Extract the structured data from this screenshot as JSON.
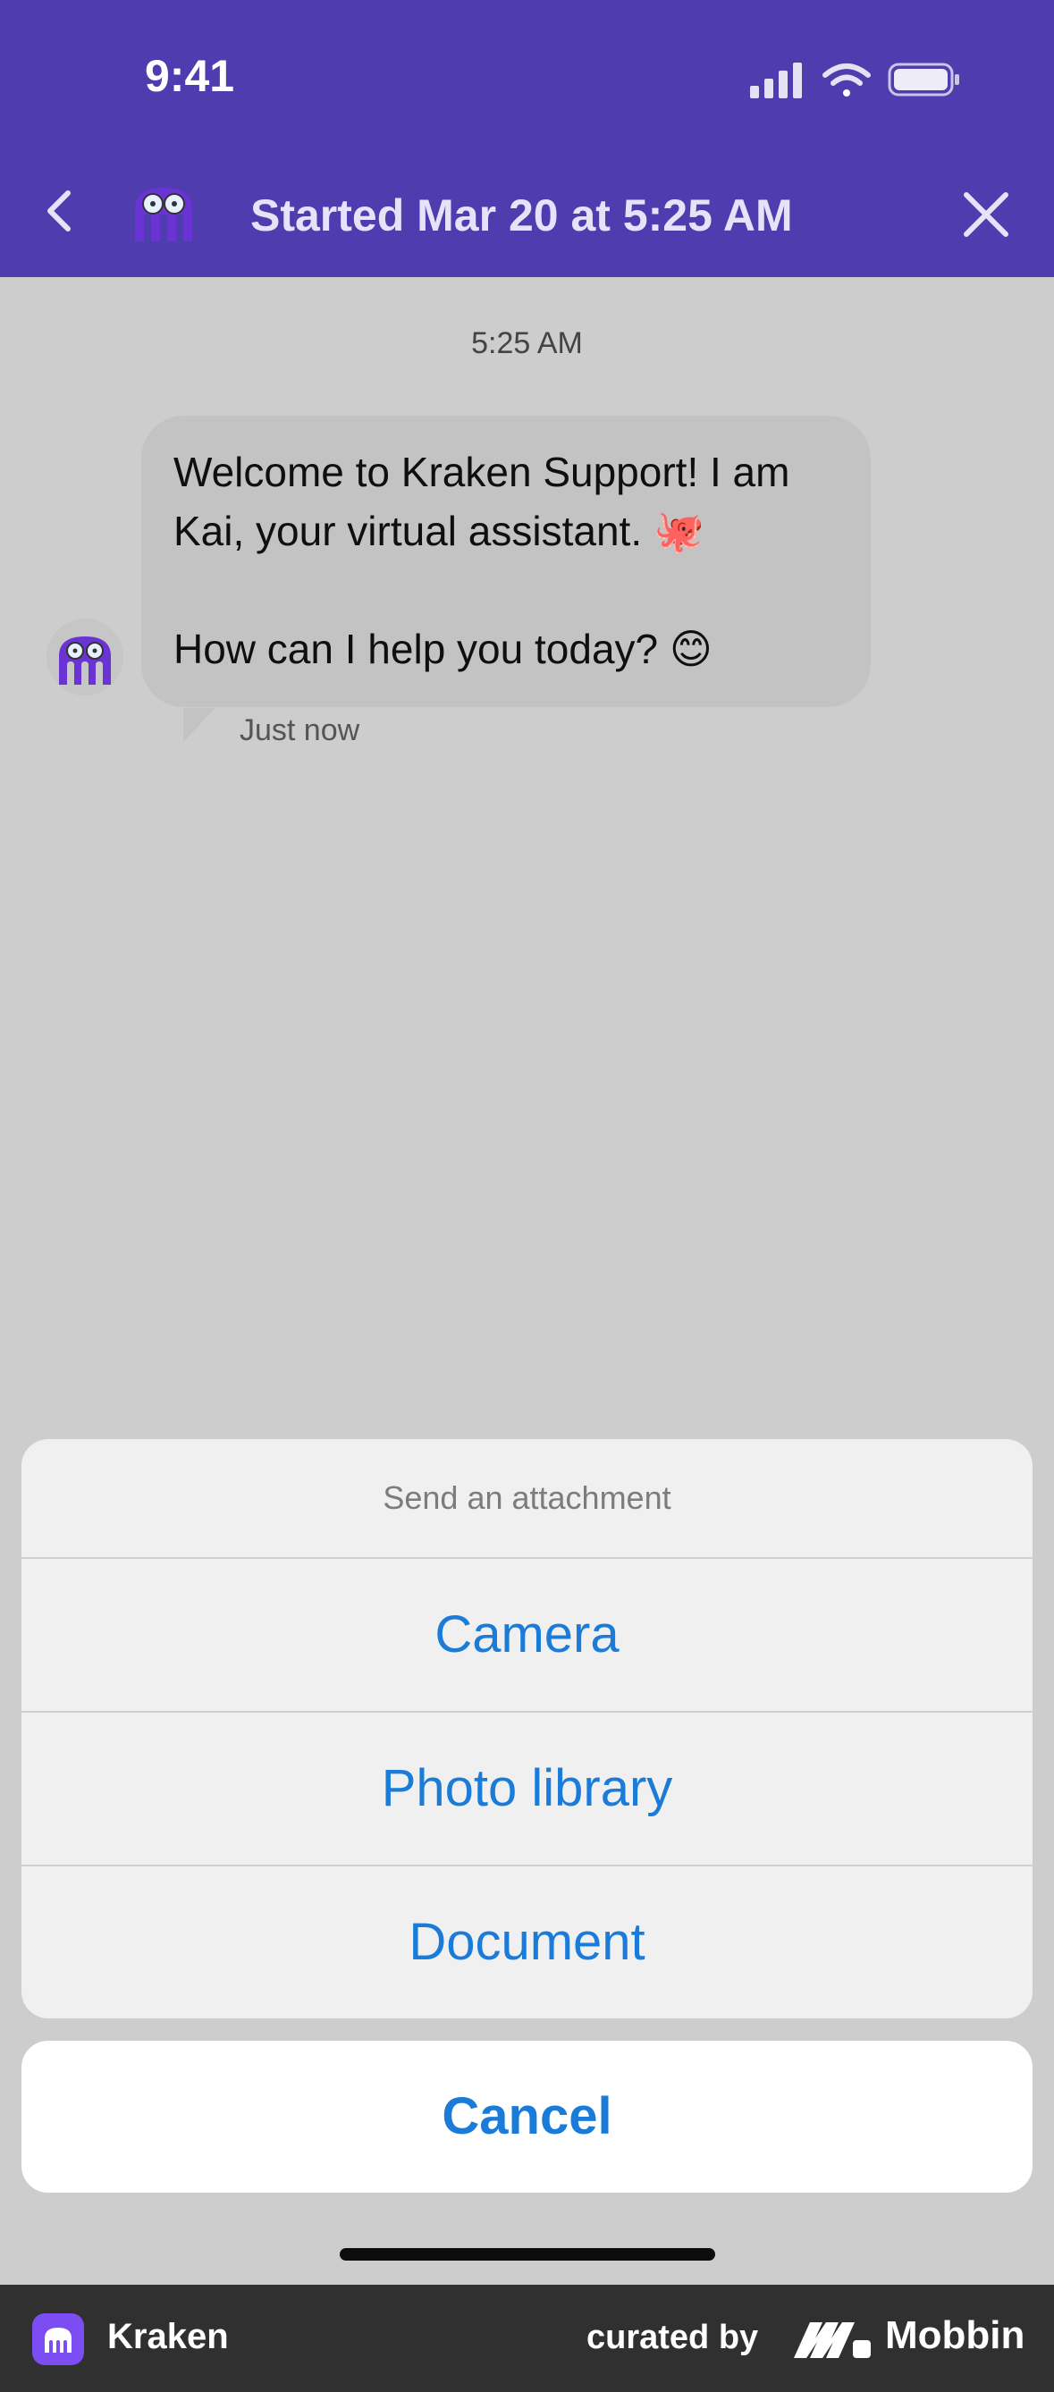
{
  "status_bar": {
    "time": "9:41",
    "icons": [
      "signal-icon",
      "wifi-icon",
      "battery-icon"
    ]
  },
  "nav": {
    "title": "Started Mar 20 at 5:25 AM",
    "back_icon": "chevron-left-icon",
    "close_icon": "close-icon",
    "avatar_icon": "kraken-bot-avatar"
  },
  "chat": {
    "timestamp": "5:25 AM",
    "message_line1": "Welcome to Kraken Support! I am Kai, your virtual assistant. 🐙",
    "message_line2": "How can I help you today? 😊",
    "message_status": "Just now"
  },
  "action_sheet": {
    "title": "Send an attachment",
    "options": [
      "Camera",
      "Photo library",
      "Document"
    ],
    "cancel": "Cancel"
  },
  "footer": {
    "app_name": "Kraken",
    "curated_by": "curated by",
    "brand": "Mobbin"
  },
  "colors": {
    "header": "#4f3cae",
    "action": "#1a7bd9",
    "overlay_bg": "#cdcdcd"
  }
}
